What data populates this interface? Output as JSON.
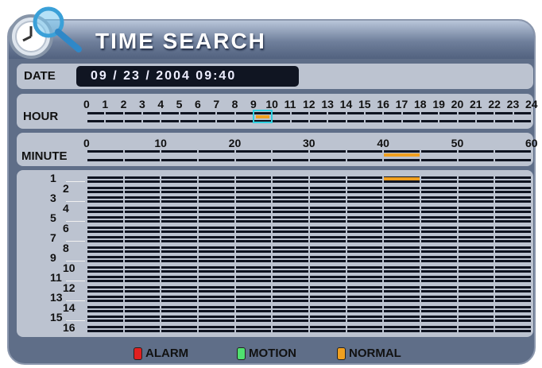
{
  "header": {
    "title": "TIME SEARCH",
    "icon": "clock-magnifier-icon"
  },
  "date": {
    "label": "DATE",
    "value": "09 / 23 / 2004  09:40"
  },
  "hour": {
    "label": "HOUR",
    "ticks": [
      "0",
      "1",
      "2",
      "3",
      "4",
      "5",
      "6",
      "7",
      "8",
      "9",
      "10",
      "11",
      "12",
      "13",
      "14",
      "15",
      "16",
      "17",
      "18",
      "19",
      "20",
      "21",
      "22",
      "23",
      "24"
    ],
    "normal_hours": [
      9
    ],
    "selected_hour": 9
  },
  "minute": {
    "label": "MINUTE",
    "ticks": [
      "0",
      "10",
      "20",
      "30",
      "40",
      "50",
      "60"
    ],
    "normal_range": [
      40,
      45
    ]
  },
  "channels": {
    "labels": [
      "1",
      "2",
      "3",
      "4",
      "5",
      "6",
      "7",
      "8",
      "9",
      "10",
      "11",
      "12",
      "13",
      "14",
      "15",
      "16"
    ],
    "normal": [
      {
        "channel": "1",
        "range": [
          40,
          45
        ]
      }
    ]
  },
  "legend": [
    {
      "label": "ALARM",
      "color": "#e02020"
    },
    {
      "label": "MOTION",
      "color": "#50e070"
    },
    {
      "label": "NORMAL",
      "color": "#f0a020"
    }
  ],
  "colors": {
    "normal": "#f0a020",
    "selected": "#30d0e0"
  }
}
